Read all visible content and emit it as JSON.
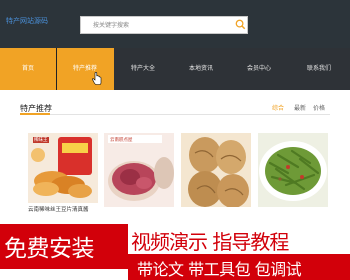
{
  "header": {
    "logo_text": "特产网站源码",
    "search_placeholder": "按关键字搜索"
  },
  "nav": {
    "items": [
      {
        "label": "首页"
      },
      {
        "label": "特产推荐"
      },
      {
        "label": "特产大全"
      },
      {
        "label": "本地资讯"
      },
      {
        "label": "会员中心"
      },
      {
        "label": "联系我们"
      }
    ]
  },
  "section": {
    "title": "特产推荐",
    "sort_tabs": [
      {
        "label": "综合"
      },
      {
        "label": "最新"
      },
      {
        "label": "价格"
      }
    ]
  },
  "products": [
    {
      "caption": "云南稀味丝王豆片清真酱",
      "badge": "稀味王"
    },
    {
      "caption": "",
      "badge": "云南糕点屋"
    },
    {
      "caption": ""
    },
    {
      "caption": ""
    }
  ],
  "promo": {
    "left_text": "免费安装",
    "right_top_text": "视频演示 指导教程",
    "right_bottom_text": "带论文 带工具包 包调试"
  },
  "colors": {
    "header_bg": "#2c343a",
    "accent_orange": "#f1a325",
    "promo_red": "#d2000a"
  }
}
